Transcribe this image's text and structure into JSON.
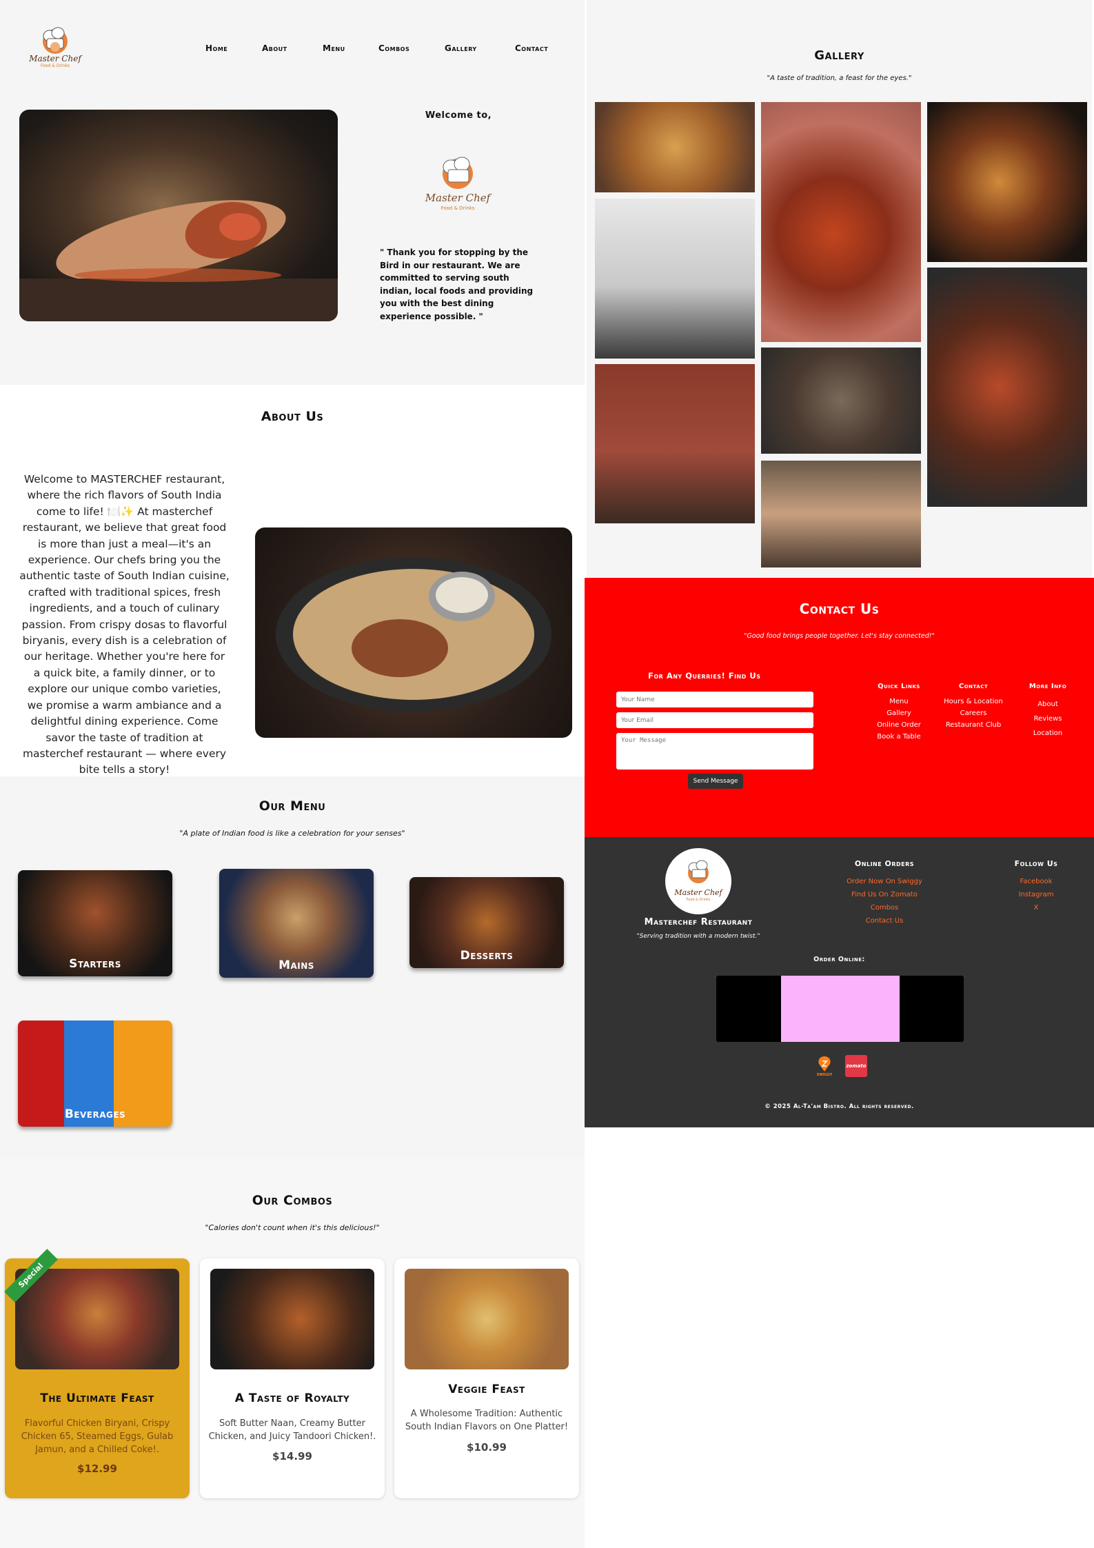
{
  "nav": {
    "logo_title": "Master Chef",
    "logo_sub": "Food & Drinks",
    "items": [
      "Home",
      "About",
      "Menu",
      "Combos",
      "Gallery",
      "Contact"
    ]
  },
  "hero": {
    "welcome": "Welcome to,",
    "logo_title": "Master Chef",
    "logo_sub": "Food & Drinks",
    "quote": "\" Thank you for stopping by the Bird in our restaurant. We are committed to serving south indian, local foods and providing you with the best dining experience possible. \""
  },
  "about": {
    "title": "About Us",
    "text": "Welcome to MASTERCHEF restaurant, where the rich flavors of South India come to life! 🍽️✨ At masterchef restaurant, we believe that great food is more than just a meal—it's an experience. Our chefs bring you the authentic taste of South Indian cuisine, crafted with traditional spices, fresh ingredients, and a touch of culinary passion. From crispy dosas to flavorful biryanis, every dish is a celebration of our heritage. Whether you're here for a quick bite, a family dinner, or to explore our unique combo varieties, we promise a warm ambiance and a delightful dining experience. Come savor the taste of tradition at masterchef restaurant — where every bite tells a story!"
  },
  "menu": {
    "title": "Our Menu",
    "subtitle": "\"A plate of Indian food is like a celebration for your senses\"",
    "cards": [
      "Starters",
      "Mains",
      "Desserts",
      "Beverages"
    ]
  },
  "combos": {
    "title": "Our Combos",
    "subtitle": "\"Calories don't count when it's this delicious!\"",
    "ribbon": "Special",
    "items": [
      {
        "name": "The Ultimate Feast",
        "desc": "Flavorful Chicken Biryani, Crispy Chicken 65, Steamed Eggs, Gulab Jamun, and a Chilled Coke!.",
        "price": "$12.99"
      },
      {
        "name": "A Taste of Royalty",
        "desc": "Soft Butter Naan, Creamy Butter Chicken, and Juicy Tandoori Chicken!.",
        "price": "$14.99"
      },
      {
        "name": "Veggie Feast",
        "desc": "A Wholesome Tradition: Authentic South Indian Flavors on One Platter!",
        "price": "$10.99"
      }
    ]
  },
  "gallery": {
    "title": "Gallery",
    "subtitle": "\"A taste of tradition, a feast for the eyes.\""
  },
  "contact": {
    "title": "Contact Us",
    "subtitle": "\"Good food brings people together. Let's stay connected!\"",
    "form_title": "For Any Querries! Find Us",
    "name_placeholder": "Your Name",
    "email_placeholder": "Your Email",
    "message_placeholder": "Your Message",
    "send": "Send Message",
    "quick_links": {
      "title": "Quick Links",
      "items": [
        "Menu",
        "Gallery",
        "Online Order",
        "Book a Table"
      ]
    },
    "contact_col": {
      "title": "Contact",
      "items": [
        "Hours & Location",
        "Careers",
        "Restaurant Club"
      ]
    },
    "more_info": {
      "title": "More Info",
      "items": [
        "About",
        "Reviews",
        "Location"
      ]
    }
  },
  "footer": {
    "logo_title": "Master Chef",
    "logo_sub": "Food & Drinks",
    "name": "Masterchef Restaurant",
    "tagline": "\"Serving tradition with a modern twist.\"",
    "online_orders": {
      "title": "Online Orders",
      "items": [
        "Order Now On Swiggy",
        "Find Us On Zomato",
        "Combos",
        "Contact Us"
      ]
    },
    "follow": {
      "title": "Follow Us",
      "items": [
        "Facebook",
        "Instagram",
        "X"
      ]
    },
    "order_online": "Order Online:",
    "swiggy": "SWIGGY",
    "zomato": "zomato",
    "copyright": "© 2025 Al-Ta'am Bistro. All rights reserved."
  },
  "colors": {
    "accent_red": "#ff0000",
    "footer_bg": "#333333",
    "special_gold": "#dfa51c",
    "link_orange": "#ff6a2a"
  }
}
